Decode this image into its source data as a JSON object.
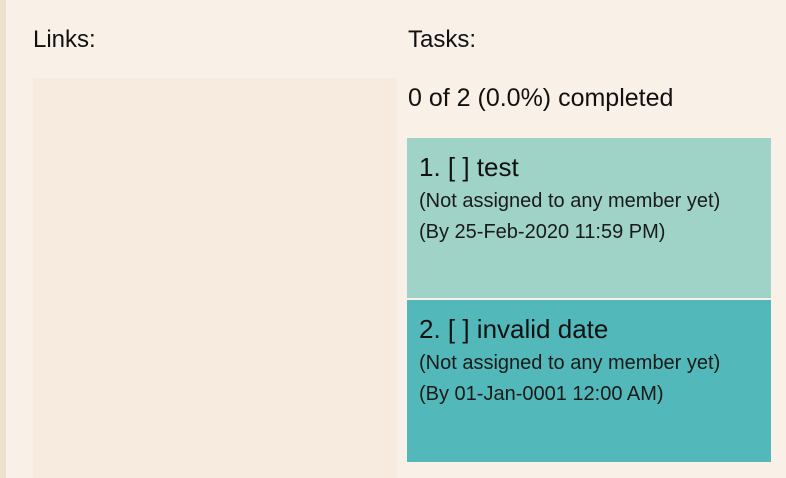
{
  "links": {
    "label": "Links:"
  },
  "tasks": {
    "label": "Tasks:",
    "progress": "0 of 2 (0.0%) completed",
    "items": [
      {
        "title": "1. [ ] test",
        "assignment": "(Not assigned to any member yet)",
        "deadline": "(By 25-Feb-2020 11:59 PM)"
      },
      {
        "title": "2. [ ] invalid date",
        "assignment": "(Not assigned to any member yet)",
        "deadline": "(By 01-Jan-0001 12:00 AM)"
      }
    ]
  },
  "colors": {
    "background": "#f9f0e7",
    "task1": "#9fd3c7",
    "task2": "#53b8b9"
  }
}
